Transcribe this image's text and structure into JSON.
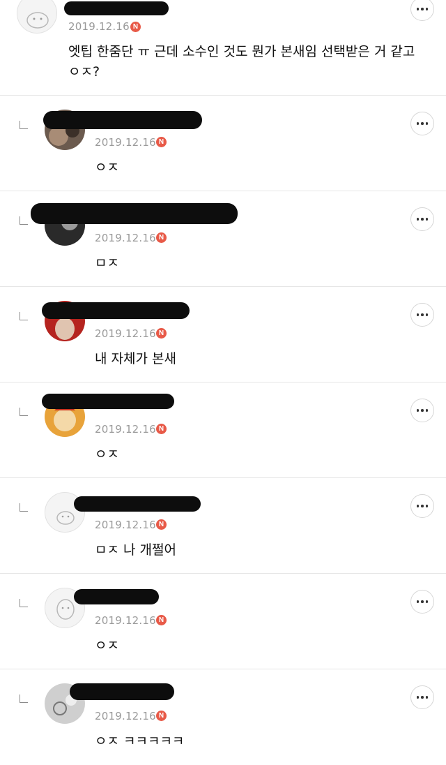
{
  "comments": [
    {
      "date": "2019.12.16",
      "badge": "N",
      "text": "엣팁 한줌단 ㅠ 근데 소수인 것도 뭔가 본새임 선택받은 거 같고 ㅇㅈ?",
      "more_icon": "more-horizontal-icon"
    },
    {
      "date": "2019.12.16",
      "badge": "N",
      "text": "ㅇㅈ",
      "reply_icon": "reply-arrow-icon",
      "more_icon": "more-horizontal-icon"
    },
    {
      "date": "2019.12.16",
      "badge": "N",
      "text": "ㅁㅈ",
      "reply_icon": "reply-arrow-icon",
      "more_icon": "more-horizontal-icon"
    },
    {
      "date": "2019.12.16",
      "badge": "N",
      "text": "내 자체가 본새",
      "reply_icon": "reply-arrow-icon",
      "more_icon": "more-horizontal-icon"
    },
    {
      "date": "2019.12.16",
      "badge": "N",
      "text": "ㅇㅈ",
      "reply_icon": "reply-arrow-icon",
      "more_icon": "more-horizontal-icon"
    },
    {
      "date": "2019.12.16",
      "badge": "N",
      "text": "ㅁㅈ 나 개쩔어",
      "reply_icon": "reply-arrow-icon",
      "more_icon": "more-horizontal-icon"
    },
    {
      "date": "2019.12.16",
      "badge": "N",
      "text": "ㅇㅈ",
      "reply_icon": "reply-arrow-icon",
      "more_icon": "more-horizontal-icon"
    },
    {
      "date": "2019.12.16",
      "badge": "N",
      "text": "ㅇㅈ ㅋㅋㅋㅋㅋ",
      "reply_icon": "reply-arrow-icon",
      "more_icon": "more-horizontal-icon"
    }
  ],
  "colors": {
    "badge": "#e85a48",
    "date": "#9a9a9a",
    "divider": "#e6e6e6",
    "redaction": "#0d0d0d"
  }
}
